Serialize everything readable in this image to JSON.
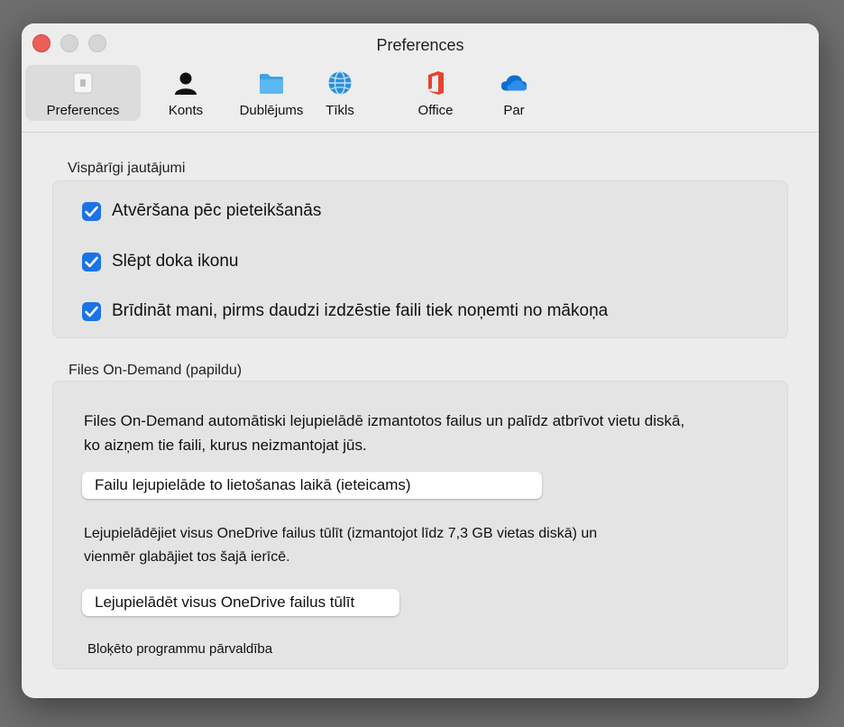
{
  "window": {
    "title": "Preferences"
  },
  "tabs": [
    {
      "label": "Preferences",
      "icon": "switch-icon",
      "active": true
    },
    {
      "label": "Konts",
      "icon": "person-icon"
    },
    {
      "label": "Dublējums",
      "icon": "folder-icon"
    },
    {
      "label": "Tīkls",
      "icon": "globe-icon"
    },
    {
      "label": "Office",
      "icon": "office-logo-icon"
    },
    {
      "label": "Par",
      "icon": "cloud-icon"
    }
  ],
  "general": {
    "title": "Vispārīgi jautājumi",
    "options": [
      {
        "label": "Atvēršana pēc pieteikšanās",
        "checked": true
      },
      {
        "label": "Slēpt doka ikonu",
        "checked": true
      },
      {
        "label": "Brīdināt mani, pirms daudzi izdzēstie faili tiek noņemti no mākoņa",
        "checked": true
      }
    ]
  },
  "files_on_demand": {
    "title": "Files On-Demand (papildu)",
    "desc_line1": "Files On-Demand automātiski lejupielādē izmantotos failus un palīdz atbrīvot vietu diskā,",
    "desc_line2": "ko aizņem tie faili, kurus neizmantojat jūs.",
    "download_on_use_button": "Failu lejupielāde to lietošanas laikā (ieteicams)",
    "download_all_desc_line1": "Lejupielādējiet visus OneDrive failus tūlīt (izmantojot līdz 7,3 GB vietas diskā) un",
    "download_all_desc_line2": "vienmēr glabājiet tos šajā ierīcē.",
    "download_all_button": "Lejupielādēt visus OneDrive failus tūlīt",
    "blocked_apps_link": "Bloķēto programmu pārvaldība"
  },
  "colors": {
    "accent": "#1a73e8",
    "close": "#ec5f59"
  }
}
